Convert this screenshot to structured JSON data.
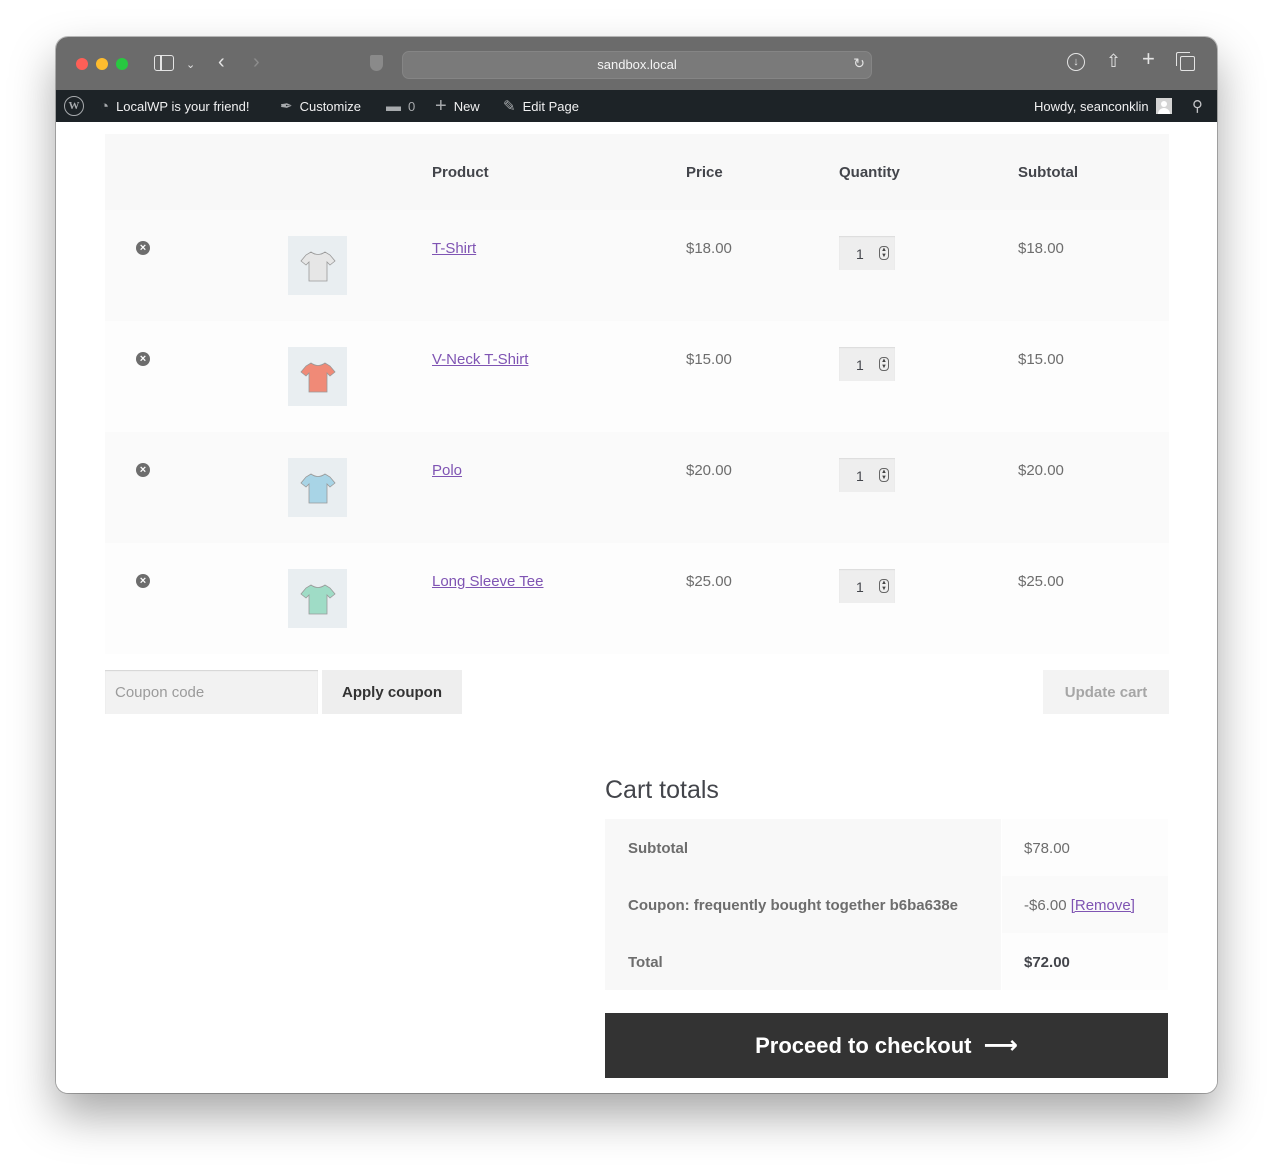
{
  "browser": {
    "url": "sandbox.local"
  },
  "adminbar": {
    "site_name": "LocalWP is your friend!",
    "customize": "Customize",
    "comments_count": "0",
    "new": "New",
    "edit_page": "Edit Page",
    "howdy": "Howdy, seanconklin"
  },
  "cart": {
    "headers": {
      "product": "Product",
      "price": "Price",
      "quantity": "Quantity",
      "subtotal": "Subtotal"
    },
    "items": [
      {
        "name": "T-Shirt",
        "price": "$18.00",
        "qty": "1",
        "subtotal": "$18.00",
        "color": "#e6e6e6"
      },
      {
        "name": "V-Neck T-Shirt",
        "price": "$15.00",
        "qty": "1",
        "subtotal": "$15.00",
        "color": "#f08a77"
      },
      {
        "name": "Polo",
        "price": "$20.00",
        "qty": "1",
        "subtotal": "$20.00",
        "color": "#a8d4e6"
      },
      {
        "name": "Long Sleeve Tee",
        "price": "$25.00",
        "qty": "1",
        "subtotal": "$25.00",
        "color": "#9fdcc6"
      }
    ],
    "coupon_placeholder": "Coupon code",
    "apply_coupon": "Apply coupon",
    "update_cart": "Update cart"
  },
  "totals": {
    "title": "Cart totals",
    "subtotal_label": "Subtotal",
    "subtotal_value": "$78.00",
    "coupon_label": "Coupon: frequently bought together b6ba638e",
    "coupon_value": "-$6.00",
    "coupon_remove": "[Remove]",
    "total_label": "Total",
    "total_value": "$72.00"
  },
  "checkout": {
    "label": "Proceed to checkout",
    "arrow": "⟶"
  },
  "colors": {
    "link": "#7f54b3",
    "button_dark": "#333333",
    "adminbar": "#1d2327"
  }
}
